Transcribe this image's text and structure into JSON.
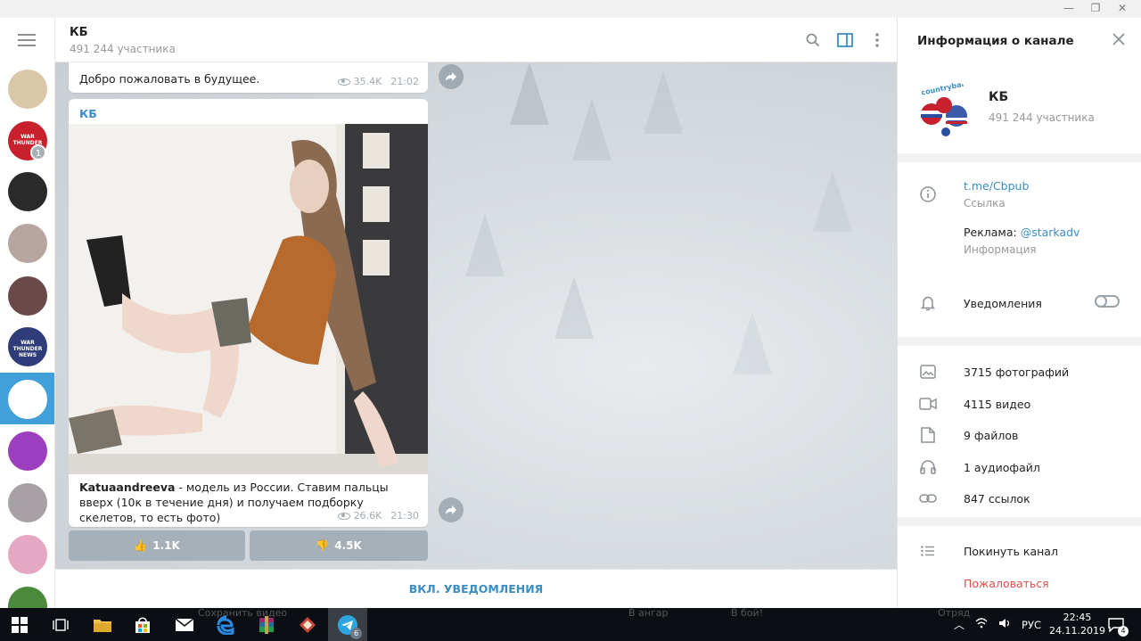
{
  "window": {
    "minimize": "—",
    "restore": "❐",
    "close": "✕"
  },
  "chat_list": {
    "unread_badge": "1",
    "avatars": [
      {
        "name": "avatar-1",
        "color": "#d9c7a8"
      },
      {
        "name": "avatar-2",
        "color": "#c8202c",
        "label": "WAR THUNDER"
      },
      {
        "name": "avatar-3",
        "color": "#2a2a2a"
      },
      {
        "name": "avatar-4",
        "color": "#b7a6a0"
      },
      {
        "name": "avatar-5",
        "color": "#6a4a48"
      },
      {
        "name": "avatar-6",
        "color": "#2e3d7a",
        "label": "WAR THUNDER NEWS"
      },
      {
        "name": "avatar-7",
        "color": "#ffffff"
      },
      {
        "name": "avatar-8",
        "color": "#9b3fbf"
      },
      {
        "name": "avatar-9",
        "color": "#a7a0a4"
      },
      {
        "name": "avatar-10",
        "color": "#e6a7c2"
      },
      {
        "name": "avatar-11",
        "color": "#4a8a3a"
      }
    ]
  },
  "chat": {
    "title": "КБ",
    "subtitle": "491 244 участника",
    "messages": [
      {
        "text": "Добро пожаловать в будущее.",
        "views": "35.4K",
        "time": "21:02"
      },
      {
        "author": "КБ",
        "caption_bold": "Katuaandreeva",
        "caption_rest": " - модель из России. Ставим пальцы вверх  (10к в течение дня) и получаем  подборку скелетов, то есть фото)",
        "views": "26.6K",
        "time": "21:30"
      }
    ],
    "reactions": [
      {
        "emoji": "👍",
        "count": "1.1K"
      },
      {
        "emoji": "👎",
        "count": "4.5K"
      }
    ],
    "notify_button": "ВКЛ. УВЕДОМЛЕНИЯ"
  },
  "info_panel": {
    "title": "Информация о канале",
    "channel_name": "КБ",
    "channel_sub": "491 244 участника",
    "avatar_text": "countryballs",
    "link": "t.me/Cbpub",
    "link_label": "Ссылка",
    "ads_prefix": "Реклама: ",
    "ads_handle": "@starkadv",
    "ads_label": "Информация",
    "notifications": "Уведомления",
    "notifications_on": false,
    "media": [
      {
        "icon": "photo-icon",
        "label": "3715 фотографий"
      },
      {
        "icon": "video-icon",
        "label": "4115 видео"
      },
      {
        "icon": "file-icon",
        "label": "9 файлов"
      },
      {
        "icon": "headphones-icon",
        "label": "1 аудиофайл"
      },
      {
        "icon": "link-icon",
        "label": "847 ссылок"
      }
    ],
    "leave": "Покинуть канал",
    "report": "Пожаловаться"
  },
  "taskbar": {
    "telegram_badge": "6",
    "ghost_texts": [
      "Сохранить видео",
      "В ангар",
      "В бой!",
      "Отряд"
    ],
    "language": "РУС",
    "time": "22:45",
    "date": "24.11.2019",
    "notif_count": "4"
  }
}
